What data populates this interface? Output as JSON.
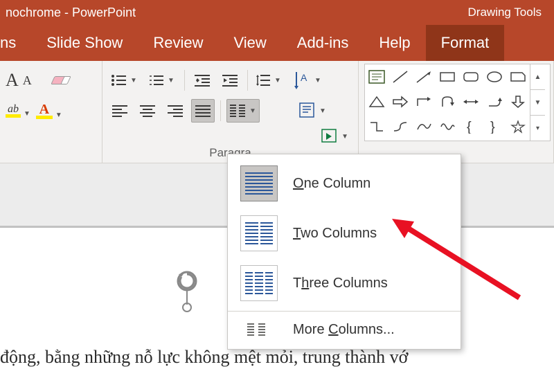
{
  "titlebar": {
    "left": "nochrome  -  PowerPoint",
    "right": "Drawing Tools"
  },
  "tabs": {
    "partial": "ns",
    "items": [
      "Slide Show",
      "Review",
      "View",
      "Add-ins",
      "Help",
      "Format"
    ],
    "active_index": 5
  },
  "paragraph": {
    "group_label": "Paragra"
  },
  "columns_menu": {
    "items": [
      {
        "label_pre": "",
        "u": "O",
        "label_post": "ne Column",
        "cols": 1,
        "selected": true
      },
      {
        "label_pre": "",
        "u": "T",
        "label_post": "wo Columns",
        "cols": 2,
        "selected": false
      },
      {
        "label_pre": "T",
        "u": "h",
        "label_post": "ree Columns",
        "cols": 3,
        "selected": false
      }
    ],
    "more": {
      "pre": "More ",
      "u": "C",
      "post": "olumns..."
    }
  },
  "slide": {
    "bottom_text": "động, bằng những nỗ lực không mệt mỏi, trung thành vớ"
  }
}
